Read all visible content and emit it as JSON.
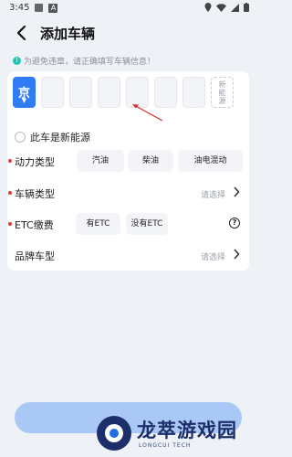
{
  "status_bar": {
    "time": "3:45"
  },
  "header": {
    "title": "添加车辆"
  },
  "notice": {
    "text": "为避免违章，请正确填写车辆信息！"
  },
  "plate": {
    "province": "京",
    "new_energy_slot_label": "新能源"
  },
  "new_energy_checkbox": {
    "label": "此车是新能源"
  },
  "power_type": {
    "label": "动力类型",
    "options": [
      "汽油",
      "柴油",
      "油电混动"
    ]
  },
  "vehicle_type": {
    "label": "车辆类型",
    "placeholder": "请选择"
  },
  "etc": {
    "label": "ETC缴费",
    "options": [
      "有ETC",
      "没有ETC"
    ],
    "help": "?"
  },
  "brand_model": {
    "label": "品牌车型",
    "placeholder": "请选择"
  },
  "watermark": {
    "title": "龙萃游戏园",
    "subtitle": "LONGCUI TECH"
  },
  "colors": {
    "accent": "#2f7cf6",
    "required": "#e53935",
    "submit_disabled": "#aac8f5"
  }
}
